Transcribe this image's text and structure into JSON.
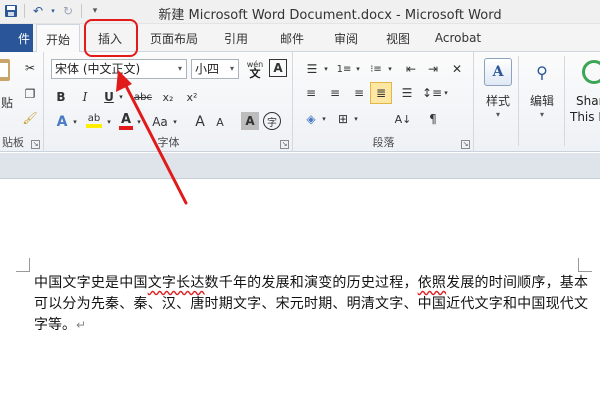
{
  "window": {
    "title": "新建 Microsoft Word Document.docx - Microsoft Word"
  },
  "qat": {
    "save_icon": "save-icon",
    "undo_icon": "undo-icon",
    "redo_icon": "redo-icon",
    "customize_icon": "dropdown-icon"
  },
  "tabs": [
    {
      "label": "件"
    },
    {
      "label": "开始"
    },
    {
      "label": "插入"
    },
    {
      "label": "页面布局"
    },
    {
      "label": "引用"
    },
    {
      "label": "邮件"
    },
    {
      "label": "审阅"
    },
    {
      "label": "视图"
    },
    {
      "label": "Acrobat"
    }
  ],
  "ribbon": {
    "clipboard": {
      "label": "贴板",
      "paste_label": "贴"
    },
    "font": {
      "label": "字体",
      "font_name": "宋体 (中文正文)",
      "font_size": "小四",
      "phonetic_label": "wén",
      "bold": "B",
      "italic": "I",
      "underline": "U",
      "strike": "abc",
      "subscript": "x₂",
      "superscript": "x²",
      "highlight": "ab",
      "font_color": "A",
      "aa": "Aa",
      "grow": "A",
      "shrink": "A",
      "char_shading": "A",
      "enclose": "字"
    },
    "paragraph": {
      "label": "段落"
    },
    "styles": {
      "label": "样式"
    },
    "editing": {
      "label": "编辑"
    },
    "share": {
      "line1": "Shar",
      "line2": "This F"
    }
  },
  "document": {
    "text_a": "中国文字史是中国",
    "text_squig": "文字长达",
    "text_b": "数千年的发展和演变的历史过程，",
    "text_squig2": "依照",
    "text_c": "发展的时间顺序，基本可以分为先秦、秦、汉、唐时期文字、宋元时期、明清文字、中国近代文字和中国现代文字等。",
    "para_mark": "↵"
  },
  "colors": {
    "file_tab": "#2a5699",
    "annotation": "#e11a1a",
    "accent": "#2b5797"
  }
}
